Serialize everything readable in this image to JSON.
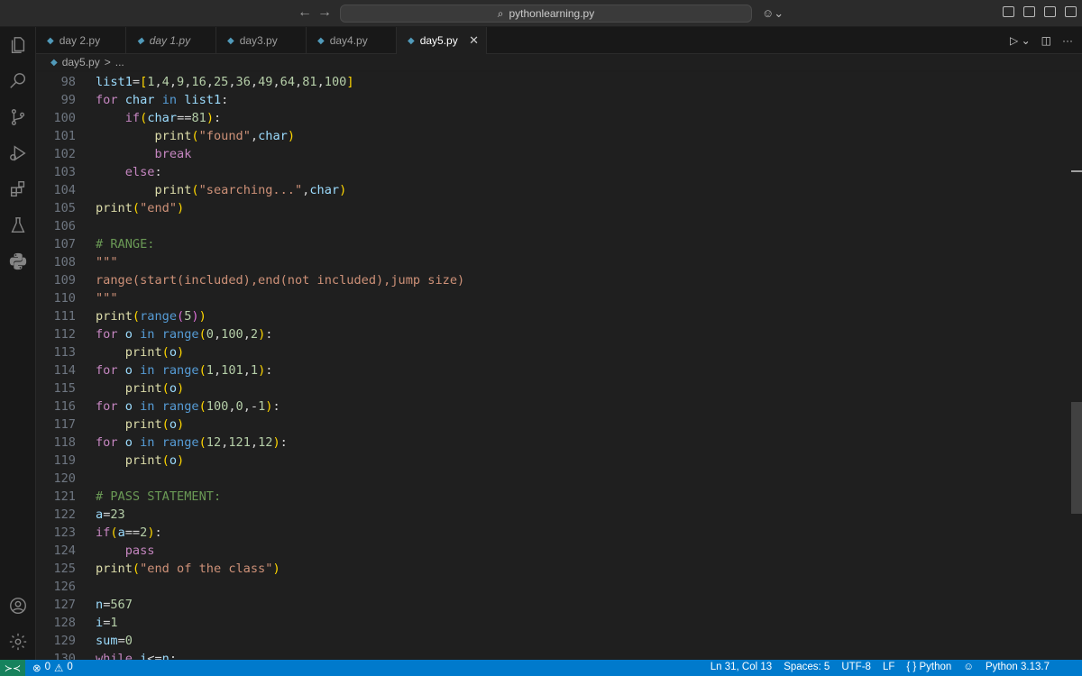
{
  "titlebar": {
    "back_icon": "arrow-left-icon",
    "forward_icon": "arrow-right-icon",
    "search_text": "pythonlearning.py",
    "copilot_icon": "copilot-icon"
  },
  "activity_bar": [
    "files-icon",
    "search-icon",
    "source-control-icon",
    "run-debug-icon",
    "extensions-icon",
    "testing-icon",
    "python-icon",
    "account-icon",
    "settings-gear-icon"
  ],
  "tabs": [
    {
      "label": "day 2.py",
      "active": false
    },
    {
      "label": "day 1.py",
      "active": false
    },
    {
      "label": "day3.py",
      "active": false
    },
    {
      "label": "day4.py",
      "active": false
    },
    {
      "label": "day5.py",
      "active": true
    }
  ],
  "breadcrumb": {
    "file": "day5.py",
    "sep": ">",
    "rest": "..."
  },
  "editor": {
    "lines": [
      {
        "n": "98",
        "t": [
          [
            "var",
            "list1"
          ],
          [
            "plain",
            "="
          ],
          [
            "pb1",
            "["
          ],
          [
            "num",
            "1"
          ],
          [
            "plain",
            ","
          ],
          [
            "num",
            "4"
          ],
          [
            "plain",
            ","
          ],
          [
            "num",
            "9"
          ],
          [
            "plain",
            ","
          ],
          [
            "num",
            "16"
          ],
          [
            "plain",
            ","
          ],
          [
            "num",
            "25"
          ],
          [
            "plain",
            ","
          ],
          [
            "num",
            "36"
          ],
          [
            "plain",
            ","
          ],
          [
            "num",
            "49"
          ],
          [
            "plain",
            ","
          ],
          [
            "num",
            "64"
          ],
          [
            "plain",
            ","
          ],
          [
            "num",
            "81"
          ],
          [
            "plain",
            ","
          ],
          [
            "num",
            "100"
          ],
          [
            "pb1",
            "]"
          ]
        ]
      },
      {
        "n": "99",
        "t": [
          [
            "kw",
            "for"
          ],
          [
            "plain",
            " "
          ],
          [
            "var",
            "char"
          ],
          [
            "plain",
            " "
          ],
          [
            "kw2",
            "in"
          ],
          [
            "plain",
            " "
          ],
          [
            "var",
            "list1"
          ],
          [
            "plain",
            ":"
          ]
        ]
      },
      {
        "n": "100",
        "t": [
          [
            "plain",
            "    "
          ],
          [
            "kw",
            "if"
          ],
          [
            "pb1",
            "("
          ],
          [
            "var",
            "char"
          ],
          [
            "plain",
            "=="
          ],
          [
            "num",
            "81"
          ],
          [
            "pb1",
            ")"
          ],
          [
            "plain",
            ":"
          ]
        ]
      },
      {
        "n": "101",
        "t": [
          [
            "plain",
            "        "
          ],
          [
            "fn",
            "print"
          ],
          [
            "pb1",
            "("
          ],
          [
            "str",
            "\"found\""
          ],
          [
            "plain",
            ","
          ],
          [
            "var",
            "char"
          ],
          [
            "pb1",
            ")"
          ]
        ]
      },
      {
        "n": "102",
        "t": [
          [
            "plain",
            "        "
          ],
          [
            "kw",
            "break"
          ]
        ]
      },
      {
        "n": "103",
        "t": [
          [
            "plain",
            "    "
          ],
          [
            "kw",
            "else"
          ],
          [
            "plain",
            ":"
          ]
        ]
      },
      {
        "n": "104",
        "t": [
          [
            "plain",
            "        "
          ],
          [
            "fn",
            "print"
          ],
          [
            "pb1",
            "("
          ],
          [
            "str",
            "\"searching...\""
          ],
          [
            "plain",
            ","
          ],
          [
            "var",
            "char"
          ],
          [
            "pb1",
            ")"
          ]
        ]
      },
      {
        "n": "105",
        "t": [
          [
            "fn",
            "print"
          ],
          [
            "pb1",
            "("
          ],
          [
            "str",
            "\"end\""
          ],
          [
            "pb1",
            ")"
          ]
        ]
      },
      {
        "n": "106",
        "t": []
      },
      {
        "n": "107",
        "t": [
          [
            "com",
            "# RANGE:"
          ]
        ]
      },
      {
        "n": "108",
        "t": [
          [
            "str",
            "\"\"\""
          ]
        ]
      },
      {
        "n": "109",
        "t": [
          [
            "str",
            "range(start(included),end(not included),jump size)"
          ]
        ]
      },
      {
        "n": "110",
        "t": [
          [
            "str",
            "\"\"\""
          ]
        ]
      },
      {
        "n": "111",
        "t": [
          [
            "fn",
            "print"
          ],
          [
            "pb1",
            "("
          ],
          [
            "kw2",
            "range"
          ],
          [
            "pb2",
            "("
          ],
          [
            "num",
            "5"
          ],
          [
            "pb2",
            ")"
          ],
          [
            "pb1",
            ")"
          ]
        ]
      },
      {
        "n": "112",
        "t": [
          [
            "kw",
            "for"
          ],
          [
            "plain",
            " "
          ],
          [
            "var",
            "o"
          ],
          [
            "plain",
            " "
          ],
          [
            "kw2",
            "in"
          ],
          [
            "plain",
            " "
          ],
          [
            "kw2",
            "range"
          ],
          [
            "pb1",
            "("
          ],
          [
            "num",
            "0"
          ],
          [
            "plain",
            ","
          ],
          [
            "num",
            "100"
          ],
          [
            "plain",
            ","
          ],
          [
            "num",
            "2"
          ],
          [
            "pb1",
            ")"
          ],
          [
            "plain",
            ":"
          ]
        ]
      },
      {
        "n": "113",
        "t": [
          [
            "plain",
            "    "
          ],
          [
            "fn",
            "print"
          ],
          [
            "pb1",
            "("
          ],
          [
            "var",
            "o"
          ],
          [
            "pb1",
            ")"
          ]
        ]
      },
      {
        "n": "114",
        "t": [
          [
            "kw",
            "for"
          ],
          [
            "plain",
            " "
          ],
          [
            "var",
            "o"
          ],
          [
            "plain",
            " "
          ],
          [
            "kw2",
            "in"
          ],
          [
            "plain",
            " "
          ],
          [
            "kw2",
            "range"
          ],
          [
            "pb1",
            "("
          ],
          [
            "num",
            "1"
          ],
          [
            "plain",
            ","
          ],
          [
            "num",
            "101"
          ],
          [
            "plain",
            ","
          ],
          [
            "num",
            "1"
          ],
          [
            "pb1",
            ")"
          ],
          [
            "plain",
            ":"
          ]
        ]
      },
      {
        "n": "115",
        "t": [
          [
            "plain",
            "    "
          ],
          [
            "fn",
            "print"
          ],
          [
            "pb1",
            "("
          ],
          [
            "var",
            "o"
          ],
          [
            "pb1",
            ")"
          ]
        ]
      },
      {
        "n": "116",
        "t": [
          [
            "kw",
            "for"
          ],
          [
            "plain",
            " "
          ],
          [
            "var",
            "o"
          ],
          [
            "plain",
            " "
          ],
          [
            "kw2",
            "in"
          ],
          [
            "plain",
            " "
          ],
          [
            "kw2",
            "range"
          ],
          [
            "pb1",
            "("
          ],
          [
            "num",
            "100"
          ],
          [
            "plain",
            ","
          ],
          [
            "num",
            "0"
          ],
          [
            "plain",
            ","
          ],
          [
            "plain",
            "-"
          ],
          [
            "num",
            "1"
          ],
          [
            "pb1",
            ")"
          ],
          [
            "plain",
            ":"
          ]
        ]
      },
      {
        "n": "117",
        "t": [
          [
            "plain",
            "    "
          ],
          [
            "fn",
            "print"
          ],
          [
            "pb1",
            "("
          ],
          [
            "var",
            "o"
          ],
          [
            "pb1",
            ")"
          ]
        ]
      },
      {
        "n": "118",
        "t": [
          [
            "kw",
            "for"
          ],
          [
            "plain",
            " "
          ],
          [
            "var",
            "o"
          ],
          [
            "plain",
            " "
          ],
          [
            "kw2",
            "in"
          ],
          [
            "plain",
            " "
          ],
          [
            "kw2",
            "range"
          ],
          [
            "pb1",
            "("
          ],
          [
            "num",
            "12"
          ],
          [
            "plain",
            ","
          ],
          [
            "num",
            "121"
          ],
          [
            "plain",
            ","
          ],
          [
            "num",
            "12"
          ],
          [
            "pb1",
            ")"
          ],
          [
            "plain",
            ":"
          ]
        ]
      },
      {
        "n": "119",
        "t": [
          [
            "plain",
            "    "
          ],
          [
            "fn",
            "print"
          ],
          [
            "pb1",
            "("
          ],
          [
            "var",
            "o"
          ],
          [
            "pb1",
            ")"
          ]
        ]
      },
      {
        "n": "120",
        "t": []
      },
      {
        "n": "121",
        "t": [
          [
            "com",
            "# PASS STATEMENT:"
          ]
        ]
      },
      {
        "n": "122",
        "t": [
          [
            "var",
            "a"
          ],
          [
            "plain",
            "="
          ],
          [
            "num",
            "23"
          ]
        ]
      },
      {
        "n": "123",
        "t": [
          [
            "kw",
            "if"
          ],
          [
            "pb1",
            "("
          ],
          [
            "var",
            "a"
          ],
          [
            "plain",
            "=="
          ],
          [
            "num",
            "2"
          ],
          [
            "pb1",
            ")"
          ],
          [
            "plain",
            ":"
          ]
        ]
      },
      {
        "n": "124",
        "t": [
          [
            "plain",
            "    "
          ],
          [
            "kw",
            "pass"
          ]
        ]
      },
      {
        "n": "125",
        "t": [
          [
            "fn",
            "print"
          ],
          [
            "pb1",
            "("
          ],
          [
            "str",
            "\"end of the class\""
          ],
          [
            "pb1",
            ")"
          ]
        ]
      },
      {
        "n": "126",
        "t": []
      },
      {
        "n": "127",
        "t": [
          [
            "var",
            "n"
          ],
          [
            "plain",
            "="
          ],
          [
            "num",
            "567"
          ]
        ]
      },
      {
        "n": "128",
        "t": [
          [
            "var",
            "i"
          ],
          [
            "plain",
            "="
          ],
          [
            "num",
            "1"
          ]
        ]
      },
      {
        "n": "129",
        "t": [
          [
            "var",
            "sum"
          ],
          [
            "plain",
            "="
          ],
          [
            "num",
            "0"
          ]
        ]
      },
      {
        "n": "130",
        "t": [
          [
            "kw",
            "while"
          ],
          [
            "plain",
            " "
          ],
          [
            "var",
            "i"
          ],
          [
            "plain",
            "<="
          ],
          [
            "var",
            "n"
          ],
          [
            "plain",
            ":"
          ]
        ]
      }
    ]
  },
  "statusbar": {
    "remote_icon": "remote-icon",
    "errors": "0",
    "warnings": "0",
    "position": "Ln 31, Col 13",
    "spaces": "Spaces: 5",
    "encoding": "UTF-8",
    "eol": "LF",
    "language": "Python",
    "interpreter": "Python 3.13.7"
  },
  "colors": {
    "statusbar": "#007acc",
    "editor_bg": "#1f1f1f",
    "activity_bg": "#181818"
  }
}
